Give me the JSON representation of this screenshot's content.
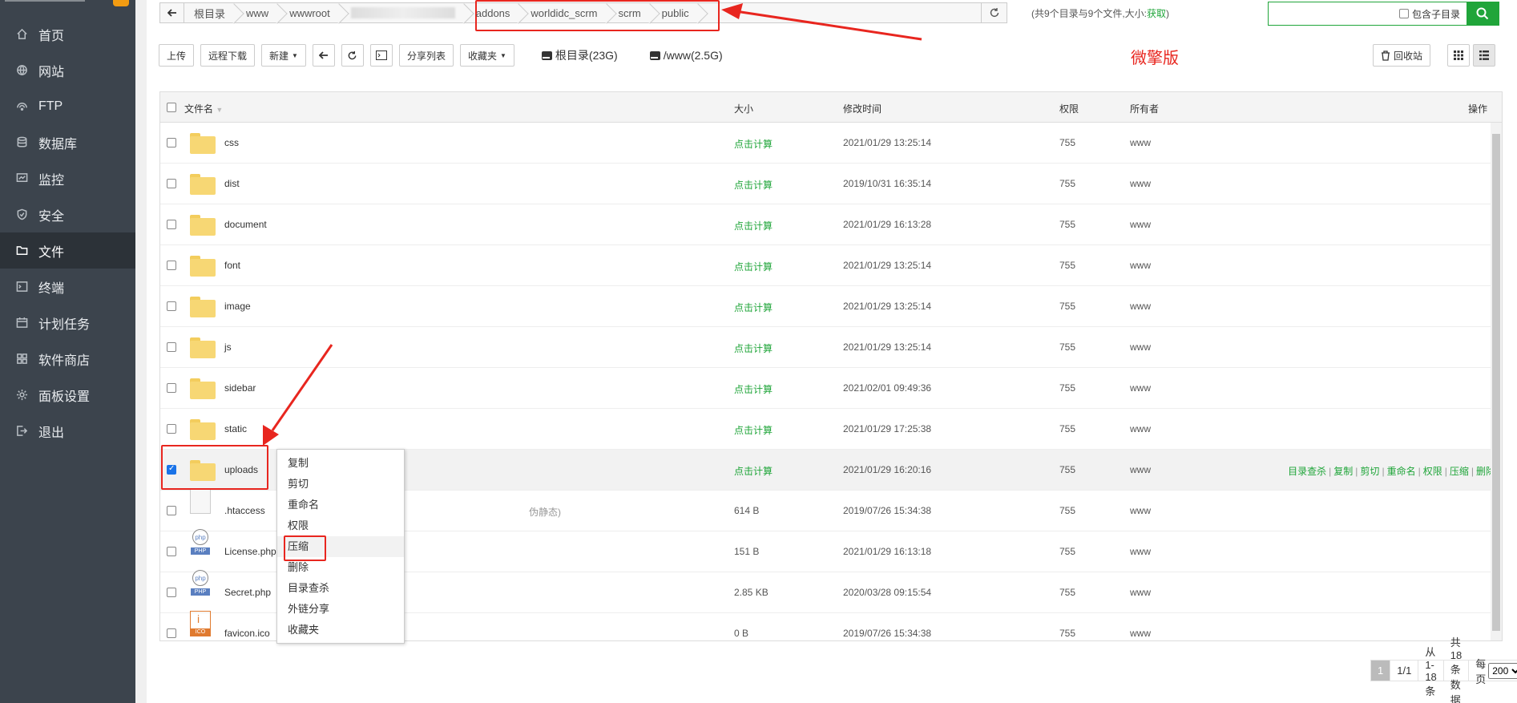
{
  "sidebar": {
    "items": [
      {
        "label": "首页",
        "icon": "home-icon"
      },
      {
        "label": "网站",
        "icon": "globe-icon"
      },
      {
        "label": "FTP",
        "icon": "ftp-icon"
      },
      {
        "label": "数据库",
        "icon": "database-icon"
      },
      {
        "label": "监控",
        "icon": "monitor-icon"
      },
      {
        "label": "安全",
        "icon": "shield-icon"
      },
      {
        "label": "文件",
        "icon": "folder-icon",
        "active": true
      },
      {
        "label": "终端",
        "icon": "terminal-icon"
      },
      {
        "label": "计划任务",
        "icon": "calendar-icon"
      },
      {
        "label": "软件商店",
        "icon": "grid-icon"
      },
      {
        "label": "面板设置",
        "icon": "gear-icon"
      },
      {
        "label": "退出",
        "icon": "logout-icon"
      }
    ]
  },
  "path": {
    "crumbs": [
      "根目录",
      "www",
      "wwwroot",
      "",
      "addons",
      "worldidc_scrm",
      "scrm",
      "public"
    ],
    "summary_prefix": "(共9个目录与9个文件,大小:",
    "summary_link": "获取",
    "summary_suffix": ")"
  },
  "search": {
    "subdir_label": "包含子目录"
  },
  "toolbar": {
    "upload": "上传",
    "remote_download": "远程下载",
    "new": "新建",
    "share_list": "分享列表",
    "favorites": "收藏夹",
    "disk_root": "根目录(23G)",
    "disk_www": "/www(2.5G)",
    "recycle": "回收站"
  },
  "annotation_label": "微擎版",
  "table": {
    "headers": {
      "name": "文件名",
      "size": "大小",
      "mtime": "修改时间",
      "perm": "权限",
      "owner": "所有者",
      "ops": "操作"
    },
    "rows": [
      {
        "name": "css",
        "type": "folder",
        "size": "点击计算",
        "mtime": "2021/01/29 13:25:14",
        "perm": "755",
        "owner": "www"
      },
      {
        "name": "dist",
        "type": "folder",
        "size": "点击计算",
        "mtime": "2019/10/31 16:35:14",
        "perm": "755",
        "owner": "www"
      },
      {
        "name": "document",
        "type": "folder",
        "size": "点击计算",
        "mtime": "2021/01/29 16:13:28",
        "perm": "755",
        "owner": "www"
      },
      {
        "name": "font",
        "type": "folder",
        "size": "点击计算",
        "mtime": "2021/01/29 13:25:14",
        "perm": "755",
        "owner": "www"
      },
      {
        "name": "image",
        "type": "folder",
        "size": "点击计算",
        "mtime": "2021/01/29 13:25:14",
        "perm": "755",
        "owner": "www"
      },
      {
        "name": "js",
        "type": "folder",
        "size": "点击计算",
        "mtime": "2021/01/29 13:25:14",
        "perm": "755",
        "owner": "www"
      },
      {
        "name": "sidebar",
        "type": "folder",
        "size": "点击计算",
        "mtime": "2021/02/01 09:49:36",
        "perm": "755",
        "owner": "www"
      },
      {
        "name": "static",
        "type": "folder",
        "size": "点击计算",
        "mtime": "2021/01/29 17:25:38",
        "perm": "755",
        "owner": "www"
      },
      {
        "name": "uploads",
        "type": "folder",
        "size": "点击计算",
        "mtime": "2021/01/29 16:20:16",
        "perm": "755",
        "owner": "www",
        "selected": true
      },
      {
        "name": ".htaccess",
        "type": "file",
        "size": "614 B",
        "mtime": "2019/07/26 15:34:38",
        "perm": "755",
        "owner": "www",
        "note": "伪静态)"
      },
      {
        "name": "License.php",
        "type": "php",
        "size": "151 B",
        "mtime": "2021/01/29 16:13:18",
        "perm": "755",
        "owner": "www"
      },
      {
        "name": "Secret.php",
        "type": "php",
        "size": "2.85 KB",
        "mtime": "2020/03/28 09:15:54",
        "perm": "755",
        "owner": "www"
      },
      {
        "name": "favicon.ico",
        "type": "ico",
        "size": "0 B",
        "mtime": "2019/07/26 15:34:38",
        "perm": "755",
        "owner": "www"
      }
    ],
    "row_ops": [
      "目录查杀",
      "复制",
      "剪切",
      "重命名",
      "权限",
      "压缩",
      "删除"
    ]
  },
  "context_menu": [
    "复制",
    "剪切",
    "重命名",
    "权限",
    "压缩",
    "删除",
    "目录查杀",
    "外链分享",
    "收藏夹"
  ],
  "pager": {
    "current": "1",
    "pages": "1/1",
    "range": "从1-18条",
    "total": "共18条数据",
    "per_page_label": "每页",
    "per_page_value": "200",
    "unit": "条"
  },
  "colors": {
    "accent": "#20a53a",
    "annotation": "#e8261f",
    "sidebar": "#3c444d"
  }
}
